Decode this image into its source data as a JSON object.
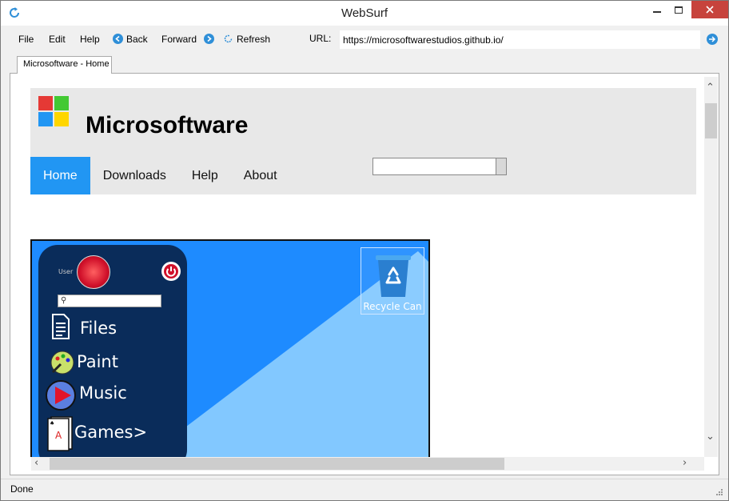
{
  "window": {
    "title": "WebSurf",
    "accent": "#2f8fd8",
    "close_color": "#c7433c"
  },
  "menu": {
    "file": "File",
    "edit": "Edit",
    "help": "Help",
    "back": "Back",
    "forward": "Forward",
    "refresh": "Refresh"
  },
  "address": {
    "label": "URL:",
    "value": "https://microsoftwarestudios.github.io/"
  },
  "tabs": [
    {
      "label": "Microsoftware - Home",
      "active": true
    }
  ],
  "page": {
    "site_title": "Microsoftware",
    "nav": [
      "Home",
      "Downloads",
      "Help",
      "About"
    ],
    "nav_active": "Home",
    "nav_active_color": "#2196f3",
    "logo_colors": [
      "#e53935",
      "#43c933",
      "#2196f3",
      "#ffd600"
    ],
    "desktop_image": {
      "user_label": "User",
      "apps": [
        "Files",
        "Paint",
        "Music",
        "Games>"
      ],
      "recycle_label": "Recycle Can"
    }
  },
  "status": {
    "text": "Done"
  }
}
